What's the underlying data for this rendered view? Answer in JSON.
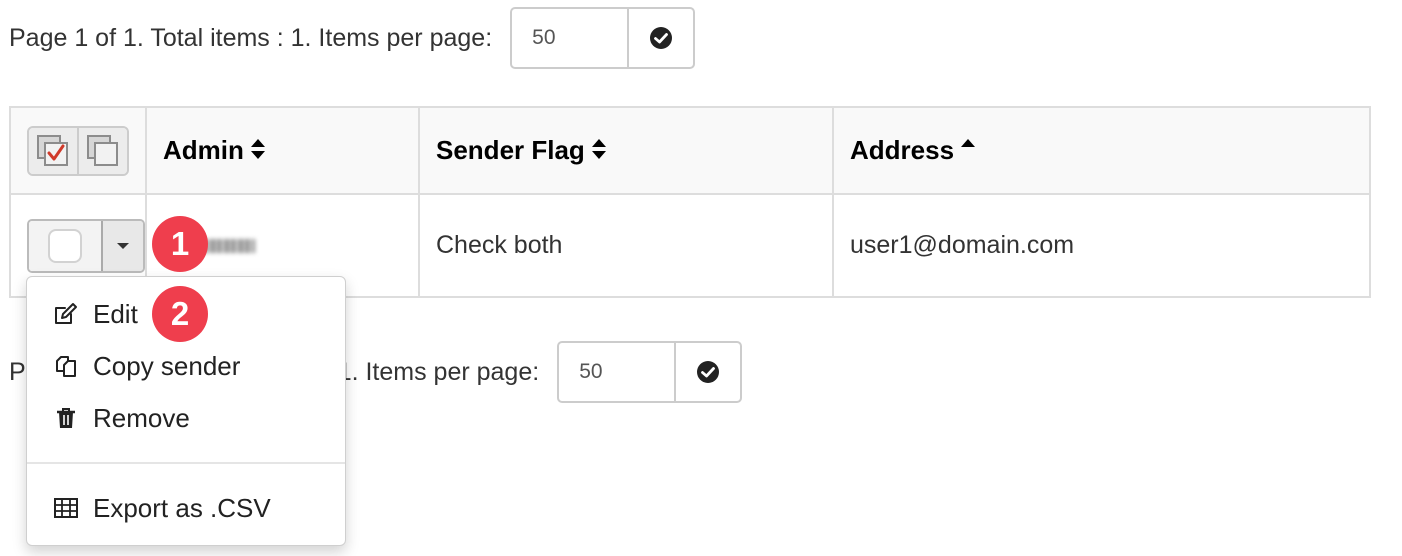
{
  "pager": {
    "top_text": "Page 1 of 1. Total items : 1. Items per page:",
    "bottom_text_left": "P",
    "bottom_text_right": "1. Items per page:",
    "items_per_page": "50",
    "apply_icon": "check-circle-icon"
  },
  "table": {
    "bulk_icons": [
      "select-all-icon",
      "deselect-all-icon"
    ],
    "columns": [
      {
        "label": "Admin",
        "sort": "both"
      },
      {
        "label": "Sender Flag",
        "sort": "both"
      },
      {
        "label": "Address",
        "sort": "asc"
      }
    ],
    "rows": [
      {
        "sender_flag": "Check both",
        "address": "user1@domain.com"
      }
    ]
  },
  "dropdown": {
    "items": [
      {
        "label": "Edit",
        "icon": "edit-icon"
      },
      {
        "label": "Copy sender",
        "icon": "copy-icon"
      },
      {
        "label": "Remove",
        "icon": "trash-icon"
      },
      {
        "label": "Export as .CSV",
        "icon": "table-icon"
      }
    ]
  },
  "badges": [
    "1",
    "2"
  ],
  "colors": {
    "badge": "#ef3e4d",
    "border": "#dddddd",
    "header_bg": "#f9f9f9"
  }
}
